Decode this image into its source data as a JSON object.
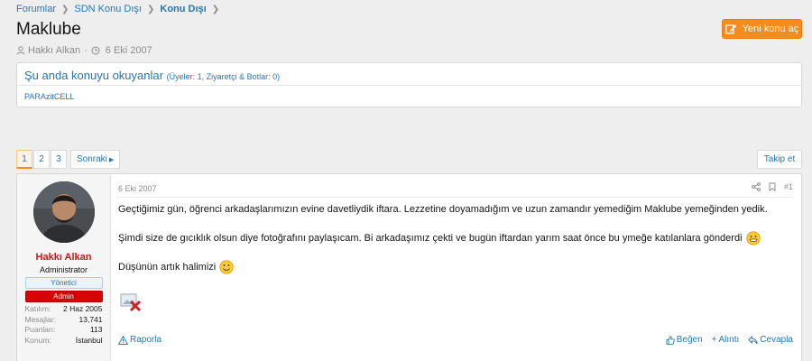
{
  "breadcrumb": {
    "items": [
      "Forumlar",
      "SDN Konu Dışı",
      "Konu Dışı"
    ]
  },
  "thread": {
    "title": "Maklube",
    "author": "Hakkı Alkan",
    "date": "6 Eki 2007",
    "new_thread_label": "Yeni konu aç"
  },
  "readers": {
    "title": "Şu anda konuyu okuyanlar",
    "counts": "(Üyeler: 1, Ziyaretçi & Botlar: 0)",
    "members": [
      "PARAzitCELL"
    ]
  },
  "pagination": {
    "pages": [
      "1",
      "2",
      "3"
    ],
    "current": "1",
    "next_label": "Sonraki"
  },
  "follow_label": "Takip et",
  "post": {
    "user": {
      "name": "Hakkı Alkan",
      "title": "Administrator",
      "banners": [
        "Yönetici",
        "Admin"
      ],
      "stats": [
        {
          "k": "Katılım:",
          "v": "2 Haz 2005"
        },
        {
          "k": "Mesajlar:",
          "v": "13,741"
        },
        {
          "k": "Puanları:",
          "v": "113"
        },
        {
          "k": "Konum:",
          "v": "İstanbul"
        }
      ]
    },
    "date": "6 Eki 2007",
    "number": "#1",
    "paragraphs": [
      "Geçtiğimiz gün, öğrenci arkadaşlarımızın evine davetliydik iftara. Lezzetine doyamadığım ve uzun zamandır yemediğim Maklube yemeğinden yedik.",
      "Şimdi size de gıcıklık olsun diye fotoğrafını paylaşıcam. Bi arkadaşımız çekti ve bugün iftardan yarım saat önce bu ymeğe katılanlara gönderdi",
      "Düşünün artık halimizi"
    ],
    "actions": {
      "report": "Raporla",
      "like": "Beğen",
      "quote": "Alıntı",
      "reply": "Cevapla"
    }
  },
  "colors": {
    "link": "#2577b1",
    "accent": "#f78c1e",
    "username": "#c81919",
    "admin_banner": "#d90000"
  }
}
